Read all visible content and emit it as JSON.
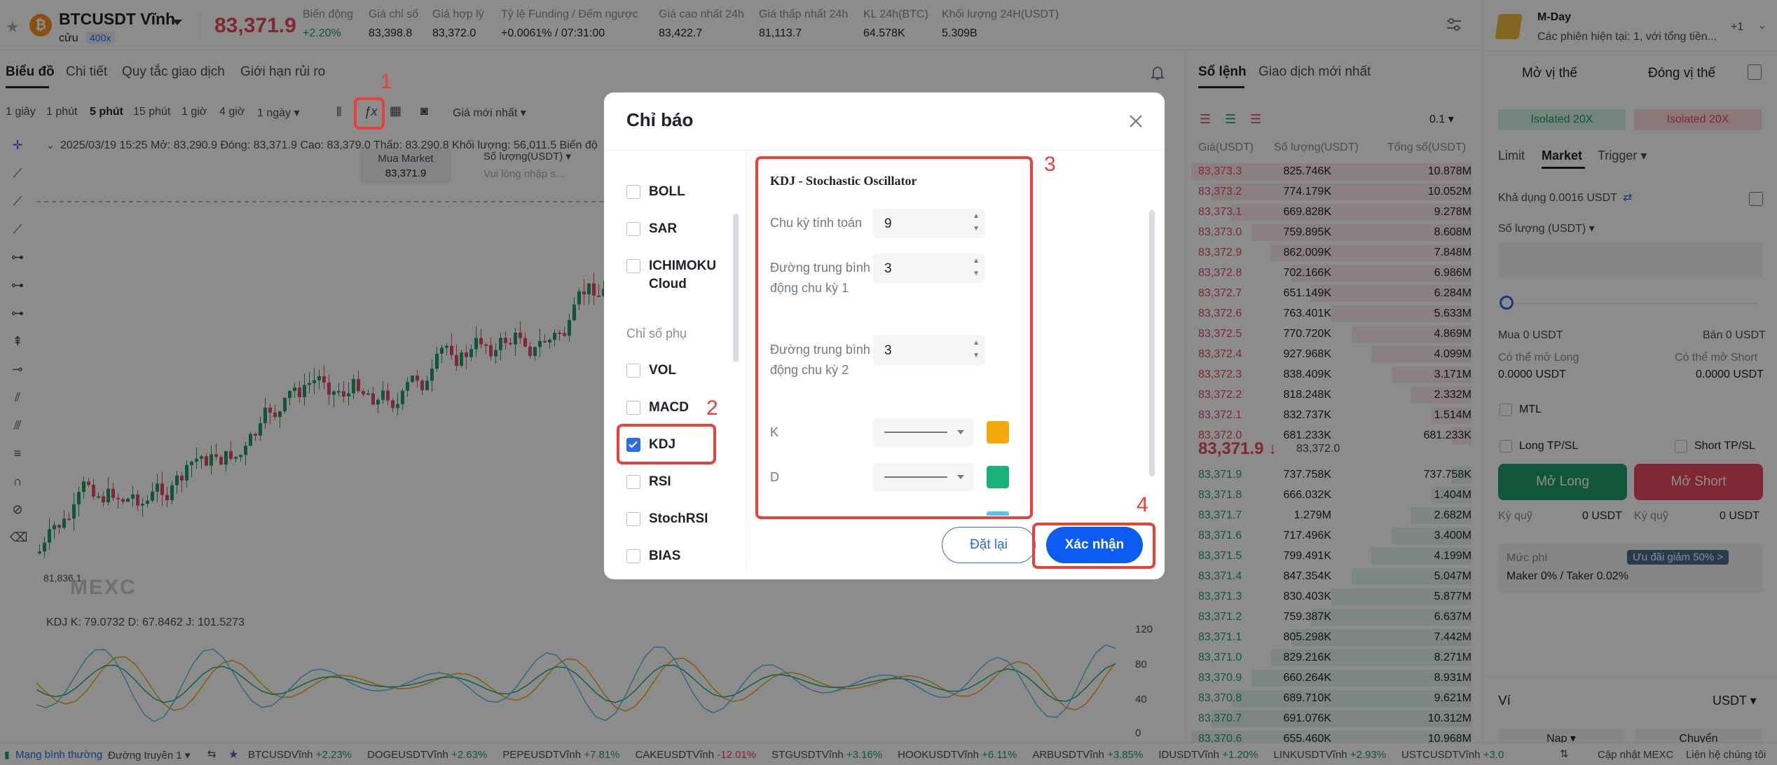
{
  "header": {
    "symbol": "BTCUSDT Vĩnh",
    "symbol_sub": "cửu",
    "leverage": "400x",
    "coin_glyph": "₿",
    "last_price": "83,371.9",
    "stats": [
      {
        "label": "Biến động",
        "value": "+2.20%",
        "green": true
      },
      {
        "label": "Giá chỉ số",
        "value": "83,398.8"
      },
      {
        "label": "Giá hợp lý",
        "value": "83,372.0"
      },
      {
        "label": "Tỷ lệ Funding / Đếm ngược",
        "value": "+0.0061% / 07:31:00"
      },
      {
        "label": "Giá cao nhất 24h",
        "value": "83,422.7"
      },
      {
        "label": "Giá thấp nhất 24h",
        "value": "81,113.7"
      },
      {
        "label": "KL 24h(BTC)",
        "value": "64.578K"
      },
      {
        "label": "Khối lượng 24H(USDT)",
        "value": "5.309B"
      }
    ]
  },
  "chart_tabs": [
    "Biểu đồ",
    "Chi tiết",
    "Quy tắc giao dịch",
    "Giới hạn rủi ro"
  ],
  "timeframes": [
    "1 giây",
    "1 phút",
    "5 phút",
    "15 phút",
    "1 giờ",
    "4 giờ",
    "1 ngày ▾"
  ],
  "price_type": "Giá mới nhất ▾",
  "chart_header": "2025/03/19 15:25  Mở: 83,290.9  Đóng: 83,371.9  Cao: 83,379.0  Thấp: 83,290.8  Khối lượng: 56,011.5  Biến độ",
  "market_mini": {
    "label": "Mua Market",
    "value": "83,371.9",
    "qty_label": "Số lượng(USDT) ▾",
    "qty_placeholder": "Vui lòng nhập s..."
  },
  "chart_low": "81,836.1",
  "kdj_label": "KDJ  K: 79.0732  D: 67.8462  J: 101.5273",
  "kdj_axis": [
    "120",
    "80",
    "40",
    "0"
  ],
  "watermark": "MEXC",
  "orderbook": {
    "tabs": [
      "Sổ lệnh",
      "Giao dịch mới nhất"
    ],
    "step": "0.1 ▾",
    "headers": [
      "Giá(USDT)",
      "Số lượng(USDT)",
      "Tổng số(USDT)"
    ],
    "asks": [
      [
        "83,373.3",
        "825.746K",
        "10.878M"
      ],
      [
        "83,373.2",
        "774.179K",
        "10.052M"
      ],
      [
        "83,373.1",
        "669.828K",
        "9.278M"
      ],
      [
        "83,373.0",
        "759.895K",
        "8.608M"
      ],
      [
        "83,372.9",
        "862.009K",
        "7.848M"
      ],
      [
        "83,372.8",
        "702.166K",
        "6.986M"
      ],
      [
        "83,372.7",
        "651.149K",
        "6.284M"
      ],
      [
        "83,372.6",
        "763.401K",
        "5.633M"
      ],
      [
        "83,372.5",
        "770.720K",
        "4.869M"
      ],
      [
        "83,372.4",
        "927.968K",
        "4.099M"
      ],
      [
        "83,372.3",
        "838.409K",
        "3.171M"
      ],
      [
        "83,372.2",
        "818.248K",
        "2.332M"
      ],
      [
        "83,372.1",
        "832.737K",
        "1.514M"
      ],
      [
        "83,372.0",
        "681.233K",
        "681.233K"
      ]
    ],
    "mid_price": "83,371.9 ↓",
    "mid_fair": "83,372.0",
    "bids": [
      [
        "83,371.9",
        "737.758K",
        "737.758K"
      ],
      [
        "83,371.8",
        "666.032K",
        "1.404M"
      ],
      [
        "83,371.7",
        "1.279M",
        "2.682M"
      ],
      [
        "83,371.6",
        "717.496K",
        "3.400M"
      ],
      [
        "83,371.5",
        "799.491K",
        "4.199M"
      ],
      [
        "83,371.4",
        "847.354K",
        "5.047M"
      ],
      [
        "83,371.3",
        "830.403K",
        "5.877M"
      ],
      [
        "83,371.2",
        "759.387K",
        "6.637M"
      ],
      [
        "83,371.1",
        "805.298K",
        "7.442M"
      ],
      [
        "83,371.0",
        "829.216K",
        "8.271M"
      ],
      [
        "83,370.9",
        "660.264K",
        "8.931M"
      ],
      [
        "83,370.8",
        "689.710K",
        "9.621M"
      ],
      [
        "83,370.7",
        "691.076K",
        "10.312M"
      ],
      [
        "83,370.6",
        "655.460K",
        "10.968M"
      ]
    ]
  },
  "right": {
    "promo_title": "M-Day",
    "promo_sub": "Các phiên hiện tại: 1, với tổng tiền...",
    "promo_count": "+1",
    "open_tab": "Mở vị thế",
    "close_tab": "Đóng vị thế",
    "iso_long": "Isolated 20X",
    "iso_short": "Isolated 20X",
    "order_types": [
      "Limit",
      "Market",
      "Trigger ▾"
    ],
    "available": "Khả dụng 0.0016 USDT",
    "qty_label": "Số lượng (USDT) ▾",
    "buy": "Mua 0 USDT",
    "sell": "Bán 0 USDT",
    "can_long": "Có thể mở Long",
    "can_short": "Có thể mở Short",
    "can_long_val": "0.0000 USDT",
    "can_short_val": "0.0000 USDT",
    "mtl": "MTL",
    "long_tpsl": "Long TP/SL",
    "short_tpsl": "Short TP/SL",
    "open_long": "Mở Long",
    "open_short": "Mở Short",
    "margin_l": "Ký quỹ",
    "margin_l_val": "0 USDT",
    "margin_s": "Ký quỹ",
    "margin_s_val": "0 USDT",
    "fee_label": "Mức phí",
    "fee_badge": "Ưu đãi giảm 50% >",
    "fee_val": "Maker 0% / Taker 0.02%",
    "wallet": "Ví",
    "wallet_ccy": "USDT ▾",
    "deposit": "Nạp ▾",
    "transfer": "Chuyển"
  },
  "bottom": {
    "network": "Mạng bình thường",
    "line": "Đường truyền 1 ▾",
    "tickers": [
      {
        "name": "BTCUSDVĩnh",
        "chg": "+2.23%",
        "up": true
      },
      {
        "name": "DOGEUSDTVĩnh",
        "chg": "+2.63%",
        "up": true
      },
      {
        "name": "PEPEUSDTVĩnh",
        "chg": "+7.81%",
        "up": true
      },
      {
        "name": "CAKEUSDTVĩnh",
        "chg": "-12.01%",
        "up": false
      },
      {
        "name": "STGUSDTVĩnh",
        "chg": "+3.16%",
        "up": true
      },
      {
        "name": "HOOKUSDTVĩnh",
        "chg": "+6.11%",
        "up": true
      },
      {
        "name": "ARBUSDTVĩnh",
        "chg": "+3.85%",
        "up": true
      },
      {
        "name": "IDUSDTVĩnh",
        "chg": "+1.20%",
        "up": true
      },
      {
        "name": "LINKUSDTVĩnh",
        "chg": "+2.93%",
        "up": true
      },
      {
        "name": "USTCUSDTVĩnh",
        "chg": "+3.0",
        "up": true
      }
    ],
    "update": "Cập nhật MEXC",
    "contact": "Liên hệ chúng tôi"
  },
  "modal": {
    "title": "Chỉ báo",
    "main_list": [
      "BOLL",
      "SAR",
      "ICHIMOKU Cloud"
    ],
    "sub_heading": "Chỉ số phụ",
    "sub_list": [
      "VOL",
      "MACD",
      "KDJ",
      "RSI",
      "StochRSI",
      "BIAS"
    ],
    "checked": "KDJ",
    "panel_title": "KDJ - Stochastic Oscillator",
    "fields": [
      {
        "label": "Chu kỳ tính toán",
        "value": "9"
      },
      {
        "label": "Đường trung bình động chu kỳ 1",
        "value": "3"
      },
      {
        "label": "Đường trung bình động chu kỳ 2",
        "value": "3"
      }
    ],
    "lines": [
      {
        "label": "K",
        "color": "#f5a80a"
      },
      {
        "label": "D",
        "color": "#19b37a"
      }
    ],
    "hidden_swatch_color": "#5bc0eb",
    "reset": "Đặt lại",
    "confirm": "Xác nhận"
  },
  "annotations": [
    "1",
    "2",
    "3",
    "4"
  ],
  "colors": {
    "up": "#1f9c6a",
    "down": "#e84a5f",
    "accent": "#0b5cf0",
    "highlight": "#e8403a"
  }
}
